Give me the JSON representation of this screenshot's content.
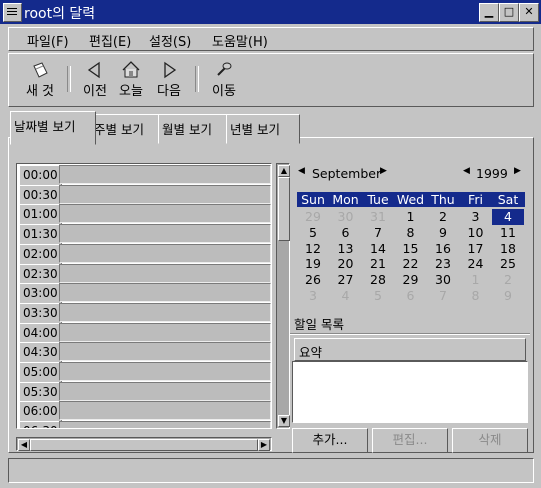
{
  "window": {
    "title": "root의 달력"
  },
  "menu": [
    "파일(F)",
    "편집(E)",
    "설정(S)",
    "도움말(H)"
  ],
  "toolbar": {
    "new": "새 것",
    "prev": "이전",
    "today": "오늘",
    "next": "다음",
    "goto": "이동"
  },
  "tabs": [
    "날짜별 보기",
    "주별 보기",
    "월별 보기",
    "년별 보기"
  ],
  "day_view": {
    "times": [
      "00:00",
      "00:30",
      "01:00",
      "01:30",
      "02:00",
      "02:30",
      "03:00",
      "03:30",
      "04:00",
      "04:30",
      "05:00",
      "05:30",
      "06:00",
      "06:30"
    ]
  },
  "calendar": {
    "month": "September",
    "year": "1999",
    "weekdays": [
      "Sun",
      "Mon",
      "Tue",
      "Wed",
      "Thu",
      "Fri",
      "Sat"
    ],
    "weeks": [
      [
        {
          "d": "29",
          "dim": true
        },
        {
          "d": "30",
          "dim": true
        },
        {
          "d": "31",
          "dim": true
        },
        {
          "d": "1"
        },
        {
          "d": "2"
        },
        {
          "d": "3"
        },
        {
          "d": "4",
          "sel": true
        }
      ],
      [
        {
          "d": "5"
        },
        {
          "d": "6"
        },
        {
          "d": "7"
        },
        {
          "d": "8"
        },
        {
          "d": "9"
        },
        {
          "d": "10"
        },
        {
          "d": "11"
        }
      ],
      [
        {
          "d": "12"
        },
        {
          "d": "13"
        },
        {
          "d": "14"
        },
        {
          "d": "15"
        },
        {
          "d": "16"
        },
        {
          "d": "17"
        },
        {
          "d": "18"
        }
      ],
      [
        {
          "d": "19"
        },
        {
          "d": "20"
        },
        {
          "d": "21"
        },
        {
          "d": "22"
        },
        {
          "d": "23"
        },
        {
          "d": "24"
        },
        {
          "d": "25"
        }
      ],
      [
        {
          "d": "26"
        },
        {
          "d": "27"
        },
        {
          "d": "28"
        },
        {
          "d": "29"
        },
        {
          "d": "30"
        },
        {
          "d": "1",
          "dim": true
        },
        {
          "d": "2",
          "dim": true
        }
      ],
      [
        {
          "d": "3",
          "dim": true
        },
        {
          "d": "4",
          "dim": true
        },
        {
          "d": "5",
          "dim": true
        },
        {
          "d": "6",
          "dim": true
        },
        {
          "d": "7",
          "dim": true
        },
        {
          "d": "8",
          "dim": true
        },
        {
          "d": "9",
          "dim": true
        }
      ]
    ]
  },
  "todo": {
    "title": "할일 목록",
    "column": "요약"
  },
  "buttons": {
    "add": "추가...",
    "edit": "편집...",
    "delete": "삭제"
  },
  "colors": {
    "titlebar": "#142a8c",
    "selection": "#142a8c",
    "face": "#c4c4c4"
  }
}
